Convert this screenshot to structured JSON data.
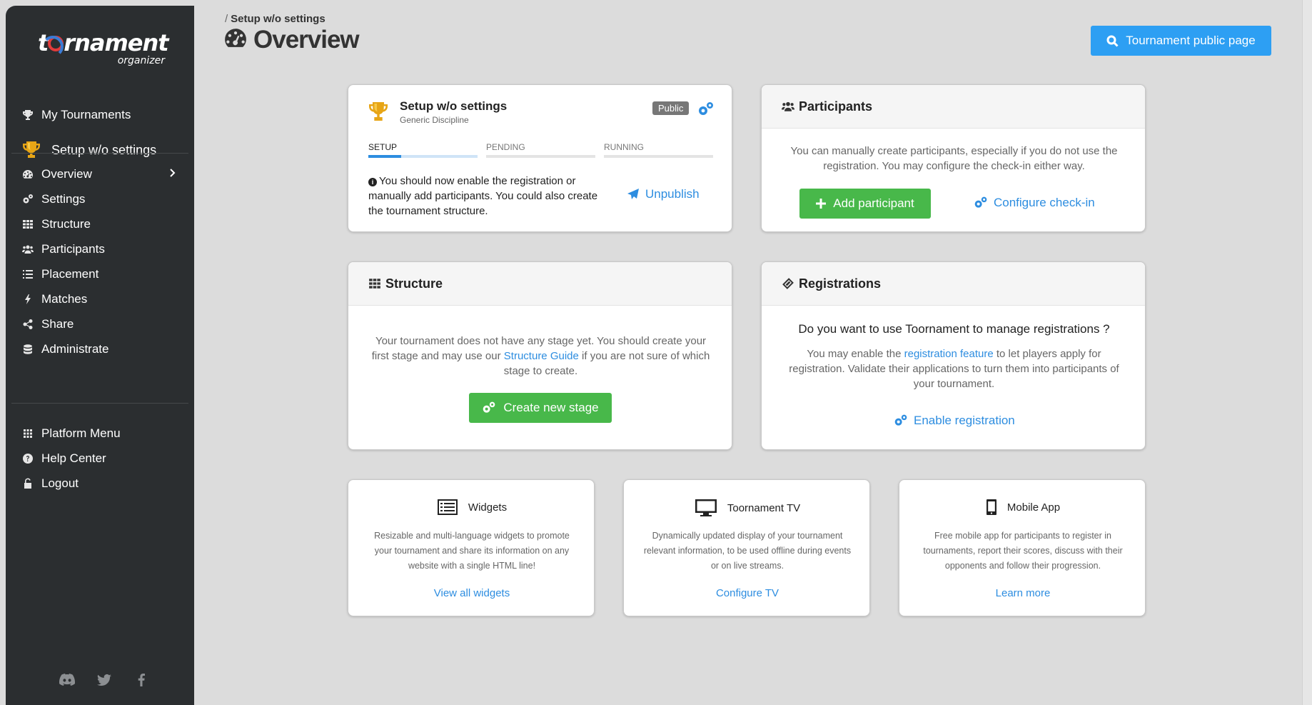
{
  "logo": {
    "main_before": "t",
    "main_after": "rnament",
    "sub": "organizer"
  },
  "sidebar": {
    "my_tournaments": "My Tournaments",
    "current_tournament": "Setup w/o settings",
    "items": [
      {
        "label": "Overview",
        "icon": "dashboard-icon"
      },
      {
        "label": "Settings",
        "icon": "gears-icon"
      },
      {
        "label": "Structure",
        "icon": "grid-icon"
      },
      {
        "label": "Participants",
        "icon": "users-icon"
      },
      {
        "label": "Placement",
        "icon": "list-icon"
      },
      {
        "label": "Matches",
        "icon": "bolt-icon"
      },
      {
        "label": "Share",
        "icon": "share-icon"
      },
      {
        "label": "Administrate",
        "icon": "database-icon"
      }
    ],
    "platform": [
      {
        "label": "Platform Menu",
        "icon": "apps-icon"
      },
      {
        "label": "Help Center",
        "icon": "question-icon"
      },
      {
        "label": "Logout",
        "icon": "unlock-icon"
      }
    ]
  },
  "header": {
    "breadcrumb_sep": "/",
    "breadcrumb": "Setup w/o settings",
    "title": "Overview",
    "public_button": "Tournament public page"
  },
  "setup_card": {
    "name": "Setup w/o settings",
    "discipline": "Generic Discipline",
    "badge": "Public",
    "steps": [
      {
        "label": "SETUP",
        "progress": 0.3
      },
      {
        "label": "PENDING",
        "progress": 0
      },
      {
        "label": "RUNNING",
        "progress": 0
      }
    ],
    "message": "You should now enable the registration or manually add participants. You could also create the tournament structure.",
    "unpublish": "Unpublish"
  },
  "participants_card": {
    "title": "Participants",
    "text": "You can manually create participants, especially if you do not use the registration. You may configure the check-in either way.",
    "add_button": "Add participant",
    "configure_link": "Configure check-in"
  },
  "structure_card": {
    "title": "Structure",
    "text_before": "Your tournament does not have any stage yet. You should create your first stage and may use our",
    "text_link": "Structure Guide",
    "text_after": "if you are not sure of which stage to create.",
    "create_button": "Create new stage"
  },
  "registrations_card": {
    "title": "Registrations",
    "question": "Do you want to use Toornament to manage registrations ?",
    "text_before": "You may enable the",
    "text_link": "registration feature",
    "text_after": "to let players apply for registration. Validate their applications to turn them into participants of your tournament.",
    "enable_link": "Enable registration"
  },
  "small_cards": [
    {
      "title": "Widgets",
      "text": "Resizable and multi-language widgets to promote your tournament and share its information on any website with a single HTML line!",
      "link": "View all widgets"
    },
    {
      "title": "Toornament TV",
      "text": "Dynamically updated display of your tournament relevant information, to be used offline during events or on live streams.",
      "link": "Configure TV"
    },
    {
      "title": "Mobile App",
      "text": "Free mobile app for participants to register in tournaments, report their scores, discuss with their opponents and follow their progression.",
      "link": "Learn more"
    }
  ],
  "colors": {
    "primary": "#2d9ff3",
    "success": "#48b84a",
    "sidebar": "#2b2e30",
    "link": "#2d8de0"
  }
}
